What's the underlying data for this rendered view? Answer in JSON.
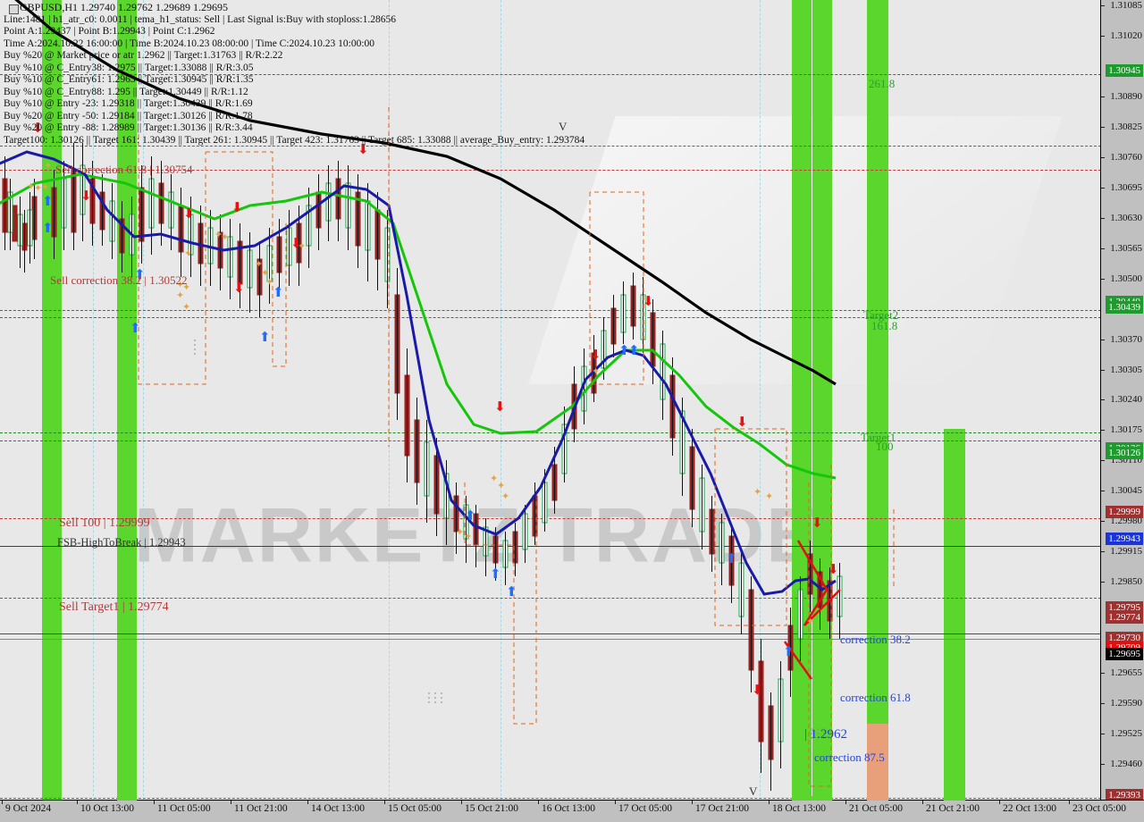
{
  "window": {
    "symbol_line": "GBPUSD,H1  1.29740 1.29762 1.29689 1.29695",
    "symbol": "GBPUSD",
    "timeframe": "H1",
    "ohlc": {
      "open": "1.29740",
      "high": "1.29762",
      "low": "1.29689",
      "close": "1.29695"
    }
  },
  "info_lines": [
    "Line:1481 | h1_atr_c0: 0.0011 | tema_h1_status: Sell | Last Signal is:Buy with stoploss:1.28656",
    "Point A:1.29437 |  Point B:1.29943 |  Point C:1.2962",
    "Time A:2024.10.22 16:00:00 | Time B:2024.10.23 08:00:00 | Time C:2024.10.23 10:00:00",
    "Buy %20 @ Market price or atr 1.2962 || Target:1.31763 || R/R:2.22",
    "Buy %10 @ C_Entry38: 1.2975 || Target:1.33088 || R/R:3.05",
    "Buy %10 @ C_Entry61: 1.2963 || Target:1.30945 || R/R:1.35",
    "Buy %10 @ C_Entry88: 1.295 || Target:1.30449 || R/R:1.12",
    "Buy %10 @ Entry -23: 1.29318 || Target:1.30439 || R/R:1.69",
    "Buy %20 @ Entry -50: 1.29184 || Target:1.30126 || R/R:1.78",
    "Buy %20 @ Entry -88: 1.28989 || Target:1.30136 || R/R:3.44",
    "Target100: 1.30126 || Target 161: 1.30439 || Target 261: 1.30945 || Target 423: 1.31763 || Target 685: 1.33088 || average_Buy_entry: 1.293784"
  ],
  "chart_data": {
    "type": "line",
    "title": "GBPUSD,H1",
    "xlabel": "",
    "ylabel": "",
    "ylim": [
      1.29393,
      1.31085
    ],
    "grid": true,
    "legend_position": "none",
    "y_ticks": [
      "1.31085",
      "1.31020",
      "1.30890",
      "1.30825",
      "1.30760",
      "1.30695",
      "1.30630",
      "1.30565",
      "1.30500",
      "1.30370",
      "1.30305",
      "1.30240",
      "1.30175",
      "1.30110",
      "1.30045",
      "1.29980",
      "1.29915",
      "1.29850",
      "1.29655",
      "1.29590",
      "1.29525",
      "1.29460"
    ],
    "x_ticks": [
      "9 Oct 2024",
      "10 Oct 13:00",
      "11 Oct 05:00",
      "11 Oct 21:00",
      "14 Oct 13:00",
      "15 Oct 05:00",
      "15 Oct 21:00",
      "16 Oct 13:00",
      "17 Oct 05:00",
      "17 Oct 21:00",
      "18 Oct 13:00",
      "21 Oct 05:00",
      "21 Oct 21:00",
      "22 Oct 13:00",
      "23 Oct 05:00"
    ],
    "price_tags": [
      {
        "value": "1.30945",
        "color": "#1f9a2f",
        "text": "#ffffff"
      },
      {
        "value": "1.30449",
        "color": "#1f9a2f",
        "text": "#ffffff"
      },
      {
        "value": "1.30439",
        "color": "#1f9a2f",
        "text": "#ffffff"
      },
      {
        "value": "1.30136",
        "color": "#1f9a2f",
        "text": "#ffffff"
      },
      {
        "value": "1.30126",
        "color": "#1f9a2f",
        "text": "#ffffff"
      },
      {
        "value": "1.29999",
        "color": "#9e3030",
        "text": "#ffffff"
      },
      {
        "value": "1.29943",
        "color": "#1a34d8",
        "text": "#ffffff"
      },
      {
        "value": "1.29795",
        "color": "#9e3030",
        "text": "#ffffff"
      },
      {
        "value": "1.29774",
        "color": "#9e3030",
        "text": "#ffffff"
      },
      {
        "value": "1.29730",
        "color": "#9e3030",
        "text": "#ffffff"
      },
      {
        "value": "1.29709",
        "color": "#e01010",
        "text": "#ffffff"
      },
      {
        "value": "1.29695",
        "color": "#000000",
        "text": "#ffffff"
      },
      {
        "value": "1.29393",
        "color": "#9e3030",
        "text": "#ffffff"
      }
    ],
    "annotations": [
      {
        "text": "Sell correction 61.8 | 1.30754",
        "color": "red"
      },
      {
        "text": "Sell correction 38.2 | 1.30522",
        "color": "red"
      },
      {
        "text": "Sell 100 | 1.29999",
        "color": "red"
      },
      {
        "text": "FSB-HighToBreak  | 1.29943",
        "color": "dark"
      },
      {
        "text": "Sell Target1 | 1.29774",
        "color": "red"
      },
      {
        "text": "261.8",
        "color": "green"
      },
      {
        "text": "Target2",
        "color": "green"
      },
      {
        "text": "161.8",
        "color": "green"
      },
      {
        "text": "Target1",
        "color": "green"
      },
      {
        "text": "100",
        "color": "green"
      },
      {
        "text": "correction 38.2",
        "color": "blue"
      },
      {
        "text": "correction 61.8",
        "color": "blue"
      },
      {
        "text": "| 1.2962",
        "color": "blue"
      },
      {
        "text": "correction 87.5",
        "color": "blue"
      }
    ]
  },
  "annotations": {
    "sell_corr_618": "Sell correction 61.8 | 1.30754",
    "sell_corr_382": "Sell correction 38.2 | 1.30522",
    "sell_100": "Sell 100 | 1.29999",
    "fsb_high": "FSB-HighToBreak  | 1.29943",
    "sell_target1": "Sell Target1 | 1.29774",
    "lv_2618": "261.8",
    "target2": "Target2",
    "lv_1618": "161.8",
    "target1": "Target1",
    "lv_100": "100",
    "corr_382": "correction 38.2",
    "corr_618": "correction 61.8",
    "point_c": "| 1.2962",
    "corr_875": "correction 87.5"
  },
  "watermark": {
    "main": "MARKETZ TRADE"
  },
  "colors": {
    "band_green": "#5ad62d",
    "band_orange": "#e8a07a",
    "ma_fast": "#16c60c",
    "ma_slow": "#1a1aa8",
    "ma_long": "#000000",
    "bull": "#17a84a",
    "bear": "#9c1f1f"
  }
}
